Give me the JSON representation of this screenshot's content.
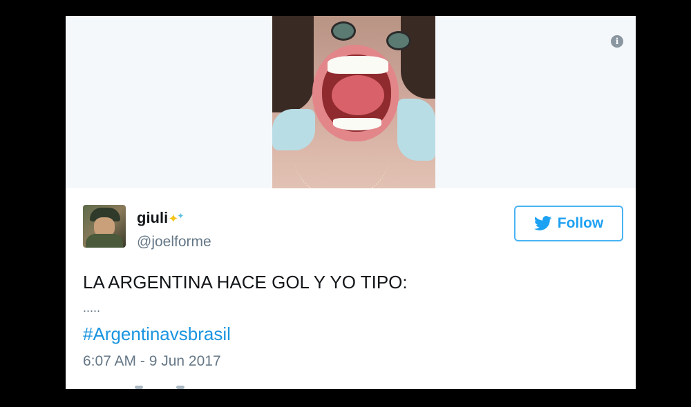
{
  "tweet": {
    "display_name": "giuli",
    "handle": "@joelforme",
    "follow_label": "Follow",
    "text": "LA ARGENTINA HACE GOL Y YO TIPO:",
    "ellipsis": ".....",
    "hashtag": "#Argentinavsbrasil",
    "timestamp": "6:07 AM - 9 Jun 2017"
  },
  "icons": {
    "info": "info-icon",
    "follow": "twitter-bird-icon",
    "sparkles": "sparkles-emoji"
  },
  "colors": {
    "accent": "#1da1f2",
    "hashtag": "#1b95e0",
    "muted": "#657786",
    "text": "#14171a",
    "media_bg": "#f5f8fa"
  }
}
